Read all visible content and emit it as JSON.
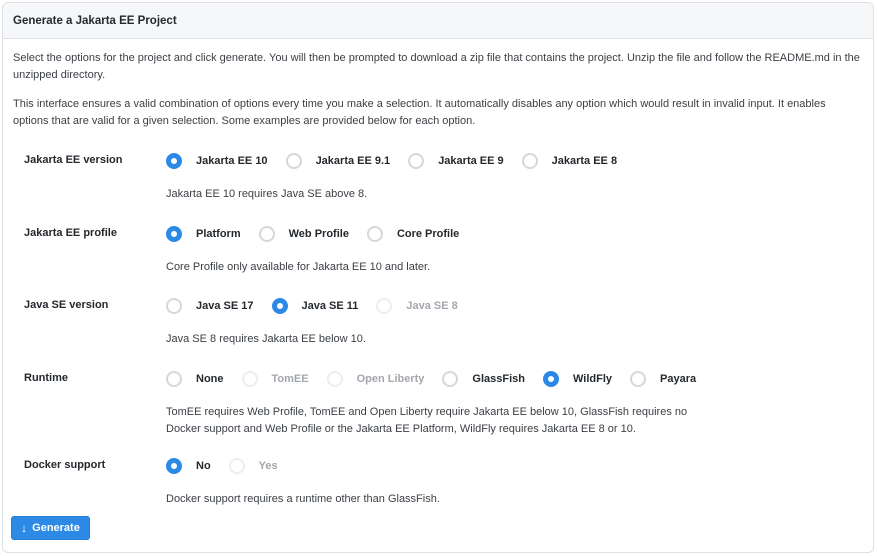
{
  "header": {
    "title": "Generate a Jakarta EE Project"
  },
  "intro": [
    "Select the options for the project and click generate. You will then be prompted to download a zip file that contains the project. Unzip the file and follow the README.md in the unzipped directory.",
    "This interface ensures a valid combination of options every time you make a selection. It automatically disables any option which would result in invalid input. It enables options that are valid for a given selection. Some examples are provided below for each option."
  ],
  "sections": [
    {
      "label": "Jakarta EE version",
      "options": [
        {
          "label": "Jakarta EE 10",
          "checked": true,
          "disabled": false
        },
        {
          "label": "Jakarta EE 9.1",
          "checked": false,
          "disabled": false
        },
        {
          "label": "Jakarta EE 9",
          "checked": false,
          "disabled": false
        },
        {
          "label": "Jakarta EE 8",
          "checked": false,
          "disabled": false
        }
      ],
      "hint": "Jakarta EE 10 requires Java SE above 8."
    },
    {
      "label": "Jakarta EE profile",
      "options": [
        {
          "label": "Platform",
          "checked": true,
          "disabled": false
        },
        {
          "label": "Web Profile",
          "checked": false,
          "disabled": false
        },
        {
          "label": "Core Profile",
          "checked": false,
          "disabled": false
        }
      ],
      "hint": "Core Profile only available for Jakarta EE 10 and later."
    },
    {
      "label": "Java SE version",
      "options": [
        {
          "label": "Java SE 17",
          "checked": false,
          "disabled": false
        },
        {
          "label": "Java SE 11",
          "checked": true,
          "disabled": false
        },
        {
          "label": "Java SE 8",
          "checked": false,
          "disabled": true
        }
      ],
      "hint": "Java SE 8 requires Jakarta EE below 10."
    },
    {
      "label": "Runtime",
      "options": [
        {
          "label": "None",
          "checked": false,
          "disabled": false
        },
        {
          "label": "TomEE",
          "checked": false,
          "disabled": true
        },
        {
          "label": "Open Liberty",
          "checked": false,
          "disabled": true
        },
        {
          "label": "GlassFish",
          "checked": false,
          "disabled": false
        },
        {
          "label": "WildFly",
          "checked": true,
          "disabled": false
        },
        {
          "label": "Payara",
          "checked": false,
          "disabled": false
        }
      ],
      "hint": "TomEE requires Web Profile, TomEE and Open Liberty require Jakarta EE below 10, GlassFish requires no Docker support and Web Profile or the Jakarta EE Platform, WildFly requires Jakarta EE 8 or 10."
    },
    {
      "label": "Docker support",
      "options": [
        {
          "label": "No",
          "checked": true,
          "disabled": false
        },
        {
          "label": "Yes",
          "checked": false,
          "disabled": true
        }
      ],
      "hint": "Docker support requires a runtime other than GlassFish."
    }
  ],
  "generate": {
    "label": "Generate",
    "icon": "arrow-down-icon"
  },
  "colors": {
    "accent": "#2c8ae6",
    "border": "#dfe1e4",
    "header_bg": "#f6f7f8"
  }
}
